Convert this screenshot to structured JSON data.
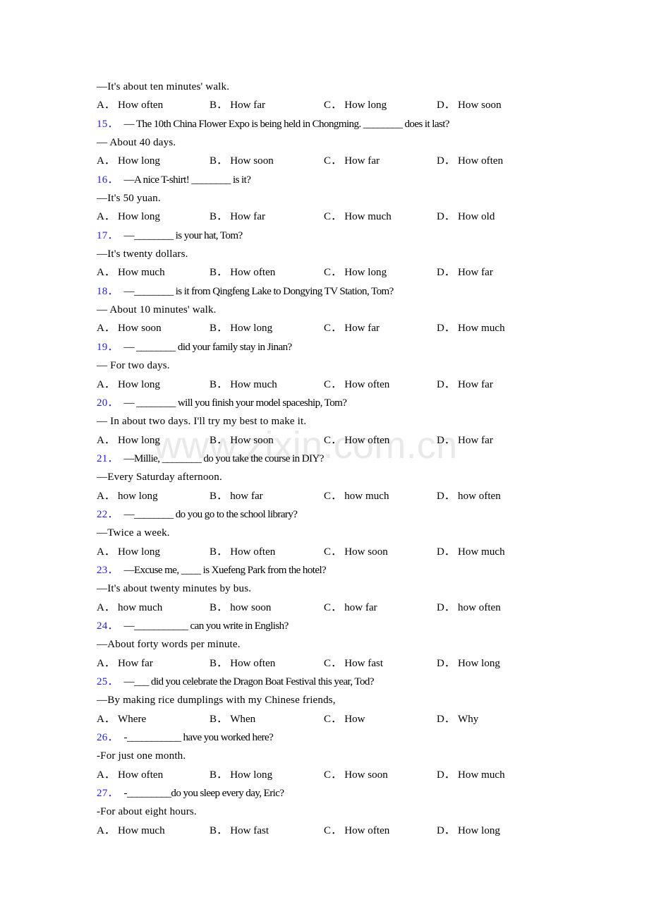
{
  "document": {
    "watermark": "www.zixin.com.cn",
    "number_color": "#2222dd",
    "text_color": "#000000",
    "background_color": "#ffffff"
  },
  "top_fragment": {
    "answer": "—It's about ten minutes' walk.",
    "options": [
      {
        "letter": "A",
        "sep": "．",
        "text": "How often"
      },
      {
        "letter": "B",
        "sep": "．",
        "text": "How far"
      },
      {
        "letter": "C",
        "sep": "．",
        "text": "How long"
      },
      {
        "letter": "D",
        "sep": "．",
        "text": "How soon"
      }
    ]
  },
  "questions": [
    {
      "number": "15",
      "dot": "．",
      "stem": "— The 10th China Flower Expo is being held in Chongming. ________ does it last?",
      "answer": "— About 40 days.",
      "options": [
        {
          "letter": "A",
          "sep": "．",
          "text": "How long"
        },
        {
          "letter": "B",
          "sep": "．",
          "text": "How soon"
        },
        {
          "letter": "C",
          "sep": "．",
          "text": "How far"
        },
        {
          "letter": "D",
          "sep": "．",
          "text": "How often"
        }
      ]
    },
    {
      "number": "16",
      "dot": "．",
      "stem": "—A nice T-shirt! ________ is it?",
      "answer": "—It's 50 yuan.",
      "options": [
        {
          "letter": "A",
          "sep": "．",
          "text": "How long"
        },
        {
          "letter": "B",
          "sep": "．",
          "text": "How far"
        },
        {
          "letter": "C",
          "sep": "．",
          "text": "How much"
        },
        {
          "letter": "D",
          "sep": "．",
          "text": "How old"
        }
      ]
    },
    {
      "number": "17",
      "dot": "．",
      "stem": "—________ is your hat, Tom?",
      "answer": "—It's twenty dollars.",
      "options": [
        {
          "letter": "A",
          "sep": "．",
          "text": "How much"
        },
        {
          "letter": "B",
          "sep": "．",
          "text": "How often"
        },
        {
          "letter": "C",
          "sep": "．",
          "text": "How long"
        },
        {
          "letter": "D",
          "sep": "．",
          "text": "How far"
        }
      ]
    },
    {
      "number": "18",
      "dot": "．",
      "stem": "—________ is it from Qingfeng Lake to Dongying TV Station, Tom?",
      "answer": "— About 10 minutes' walk.",
      "options": [
        {
          "letter": "A",
          "sep": "．",
          "text": "How soon"
        },
        {
          "letter": "B",
          "sep": "．",
          "text": "How long"
        },
        {
          "letter": "C",
          "sep": "．",
          "text": "How far"
        },
        {
          "letter": "D",
          "sep": "．",
          "text": "How much"
        }
      ]
    },
    {
      "number": "19",
      "dot": "．",
      "stem": "— ________ did your family stay in Jinan?",
      "answer": "— For two days.",
      "options": [
        {
          "letter": "A",
          "sep": "．",
          "text": "How long"
        },
        {
          "letter": "B",
          "sep": "．",
          "text": "How much"
        },
        {
          "letter": "C",
          "sep": "．",
          "text": "How often"
        },
        {
          "letter": "D",
          "sep": "．",
          "text": "How far"
        }
      ]
    },
    {
      "number": "20",
      "dot": "．",
      "stem": "— ________ will you finish your model spaceship, Tom?",
      "answer": "— In about two days. I'll try my best to make it.",
      "options": [
        {
          "letter": "A",
          "sep": "．",
          "text": "How long"
        },
        {
          "letter": "B",
          "sep": "．",
          "text": "How soon"
        },
        {
          "letter": "C",
          "sep": "．",
          "text": "How often"
        },
        {
          "letter": "D",
          "sep": "．",
          "text": "How far"
        }
      ]
    },
    {
      "number": "21",
      "dot": "．",
      "stem": "—Millie, ________ do you take the course in DIY?",
      "answer": "—Every Saturday afternoon.",
      "options": [
        {
          "letter": "A",
          "sep": "．",
          "text": "how long"
        },
        {
          "letter": "B",
          "sep": "．",
          "text": "how far"
        },
        {
          "letter": "C",
          "sep": "．",
          "text": "how much"
        },
        {
          "letter": "D",
          "sep": "．",
          "text": "how often"
        }
      ]
    },
    {
      "number": "22",
      "dot": "．",
      "stem": "—________ do you go to the school library?",
      "answer": "—Twice a week.",
      "options": [
        {
          "letter": "A",
          "sep": "．",
          "text": "How long"
        },
        {
          "letter": "B",
          "sep": "．",
          "text": "How often"
        },
        {
          "letter": "C",
          "sep": "．",
          "text": "How soon"
        },
        {
          "letter": "D",
          "sep": "．",
          "text": "How much"
        }
      ]
    },
    {
      "number": "23",
      "dot": "．",
      "stem": "—Excuse me, ____ is Xuefeng Park from the hotel?",
      "answer": "—It's about twenty minutes by bus.",
      "options": [
        {
          "letter": "A",
          "sep": "．",
          "text": "how much"
        },
        {
          "letter": "B",
          "sep": "．",
          "text": "how soon"
        },
        {
          "letter": "C",
          "sep": "．",
          "text": "how far"
        },
        {
          "letter": "D",
          "sep": "．",
          "text": "how often"
        }
      ]
    },
    {
      "number": "24",
      "dot": "．",
      "stem": "—___________ can you write in English?",
      "answer": "—About forty words per minute.",
      "options": [
        {
          "letter": "A",
          "sep": "．",
          "text": "How far"
        },
        {
          "letter": "B",
          "sep": "．",
          "text": "How often"
        },
        {
          "letter": "C",
          "sep": "．",
          "text": "How fast"
        },
        {
          "letter": "D",
          "sep": "．",
          "text": "How long"
        }
      ]
    },
    {
      "number": "25",
      "dot": "．",
      "stem": "—___ did you celebrate the Dragon Boat Festival this year, Tod?",
      "answer": "—By making rice dumplings with my Chinese friends,",
      "options": [
        {
          "letter": "A",
          "sep": "．",
          "text": "Where"
        },
        {
          "letter": "B",
          "sep": "．",
          "text": "When"
        },
        {
          "letter": "C",
          "sep": "．",
          "text": "How"
        },
        {
          "letter": "D",
          "sep": "．",
          "text": "Why"
        }
      ]
    },
    {
      "number": "26",
      "dot": "．",
      "stem": "-___________ have you worked here?",
      "answer": "-For just one month.",
      "options": [
        {
          "letter": "A",
          "sep": "．",
          "text": "How often"
        },
        {
          "letter": "B",
          "sep": "．",
          "text": "How long"
        },
        {
          "letter": "C",
          "sep": "．",
          "text": "How soon"
        },
        {
          "letter": "D",
          "sep": "．",
          "text": "How much"
        }
      ]
    },
    {
      "number": "27",
      "dot": "．",
      "stem": "-_________do you sleep every day, Eric?",
      "answer": "-For about eight hours.",
      "options": [
        {
          "letter": "A",
          "sep": "．",
          "text": "How much"
        },
        {
          "letter": "B",
          "sep": "．",
          "text": "How fast"
        },
        {
          "letter": "C",
          "sep": "．",
          "text": "How often"
        },
        {
          "letter": "D",
          "sep": "．",
          "text": "How long"
        }
      ]
    }
  ]
}
